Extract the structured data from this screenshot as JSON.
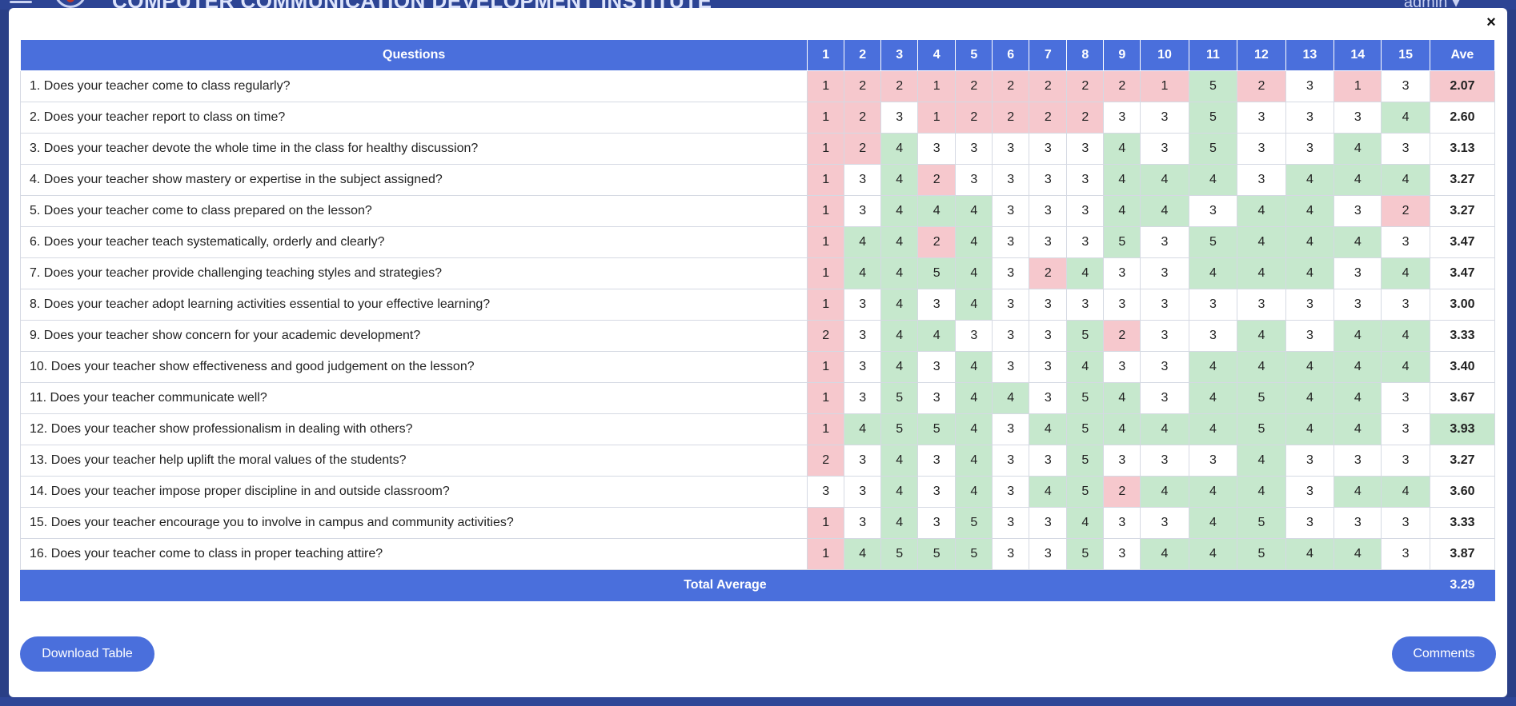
{
  "header": {
    "org_title": "COMPUTER COMMUNICATION DEVELOPMENT INSTITUTE",
    "user_label": "admin ▾"
  },
  "modal": {
    "close_icon": "×"
  },
  "table": {
    "question_header": "Questions",
    "column_headers": [
      "1",
      "2",
      "3",
      "4",
      "5",
      "6",
      "7",
      "8",
      "9",
      "10",
      "11",
      "12",
      "13",
      "14",
      "15"
    ],
    "average_header": "Ave",
    "rows": [
      {
        "q": "1. Does your teacher come to class regularly?",
        "s": [
          1,
          2,
          2,
          1,
          2,
          2,
          2,
          2,
          2,
          1,
          5,
          2,
          3,
          1,
          3
        ],
        "ave": "2.07"
      },
      {
        "q": "2. Does your teacher report to class on time?",
        "s": [
          1,
          2,
          3,
          1,
          2,
          2,
          2,
          2,
          3,
          3,
          5,
          3,
          3,
          3,
          4
        ],
        "ave": "2.60"
      },
      {
        "q": "3. Does your teacher devote the whole time in the class for healthy discussion?",
        "s": [
          1,
          2,
          4,
          3,
          3,
          3,
          3,
          3,
          4,
          3,
          5,
          3,
          3,
          4,
          3
        ],
        "ave": "3.13"
      },
      {
        "q": "4. Does your teacher show mastery or expertise in the subject assigned?",
        "s": [
          1,
          3,
          4,
          2,
          3,
          3,
          3,
          3,
          4,
          4,
          4,
          3,
          4,
          4,
          4
        ],
        "ave": "3.27"
      },
      {
        "q": "5. Does your teacher come to class prepared on the lesson?",
        "s": [
          1,
          3,
          4,
          4,
          4,
          3,
          3,
          3,
          4,
          4,
          3,
          4,
          4,
          3,
          2
        ],
        "ave": "3.27"
      },
      {
        "q": "6. Does your teacher teach systematically, orderly and clearly?",
        "s": [
          1,
          4,
          4,
          2,
          4,
          3,
          3,
          3,
          5,
          3,
          5,
          4,
          4,
          4,
          3
        ],
        "ave": "3.47"
      },
      {
        "q": "7. Does your teacher provide challenging teaching styles and strategies?",
        "s": [
          1,
          4,
          4,
          5,
          4,
          3,
          2,
          4,
          3,
          3,
          4,
          4,
          4,
          3,
          4
        ],
        "ave": "3.47"
      },
      {
        "q": "8. Does your teacher adopt learning activities essential to your effective learning?",
        "s": [
          1,
          3,
          4,
          3,
          4,
          3,
          3,
          3,
          3,
          3,
          3,
          3,
          3,
          3,
          3
        ],
        "ave": "3.00"
      },
      {
        "q": "9. Does your teacher show concern for your academic development?",
        "s": [
          2,
          3,
          4,
          4,
          3,
          3,
          3,
          5,
          2,
          3,
          3,
          4,
          3,
          4,
          4
        ],
        "ave": "3.33"
      },
      {
        "q": "10. Does your teacher show effectiveness and good judgement on the lesson?",
        "s": [
          1,
          3,
          4,
          3,
          4,
          3,
          3,
          4,
          3,
          3,
          4,
          4,
          4,
          4,
          4
        ],
        "ave": "3.40"
      },
      {
        "q": "11. Does your teacher communicate well?",
        "s": [
          1,
          3,
          5,
          3,
          4,
          4,
          3,
          5,
          4,
          3,
          4,
          5,
          4,
          4,
          3
        ],
        "ave": "3.67"
      },
      {
        "q": "12. Does your teacher show professionalism in dealing with others?",
        "s": [
          1,
          4,
          5,
          5,
          4,
          3,
          4,
          5,
          4,
          4,
          4,
          5,
          4,
          4,
          3
        ],
        "ave": "3.93"
      },
      {
        "q": "13. Does your teacher help uplift the moral values of the students?",
        "s": [
          2,
          3,
          4,
          3,
          4,
          3,
          3,
          5,
          3,
          3,
          3,
          4,
          3,
          3,
          3
        ],
        "ave": "3.27"
      },
      {
        "q": "14. Does your teacher impose proper discipline in and outside classroom?",
        "s": [
          3,
          3,
          4,
          3,
          4,
          3,
          4,
          5,
          2,
          4,
          4,
          4,
          3,
          4,
          4
        ],
        "ave": "3.60"
      },
      {
        "q": "15. Does your teacher encourage you to involve in campus and community activities?",
        "s": [
          1,
          3,
          4,
          3,
          5,
          3,
          3,
          4,
          3,
          3,
          4,
          5,
          3,
          3,
          3
        ],
        "ave": "3.33"
      },
      {
        "q": "16. Does your teacher come to class in proper teaching attire?",
        "s": [
          1,
          4,
          5,
          5,
          5,
          3,
          3,
          5,
          3,
          4,
          4,
          5,
          4,
          4,
          3
        ],
        "ave": "3.87"
      }
    ],
    "low_rows_ave": [
      "2.07"
    ],
    "high_rows_ave": [
      "3.93"
    ],
    "total_label": "Total Average",
    "total_value": "3.29"
  },
  "buttons": {
    "download_label": "Download Table",
    "comments_label": "Comments"
  },
  "colors": {
    "accent": "#4a6fdc",
    "low_highlight": "#f6c8cd",
    "high_highlight": "#c6e8cd"
  }
}
